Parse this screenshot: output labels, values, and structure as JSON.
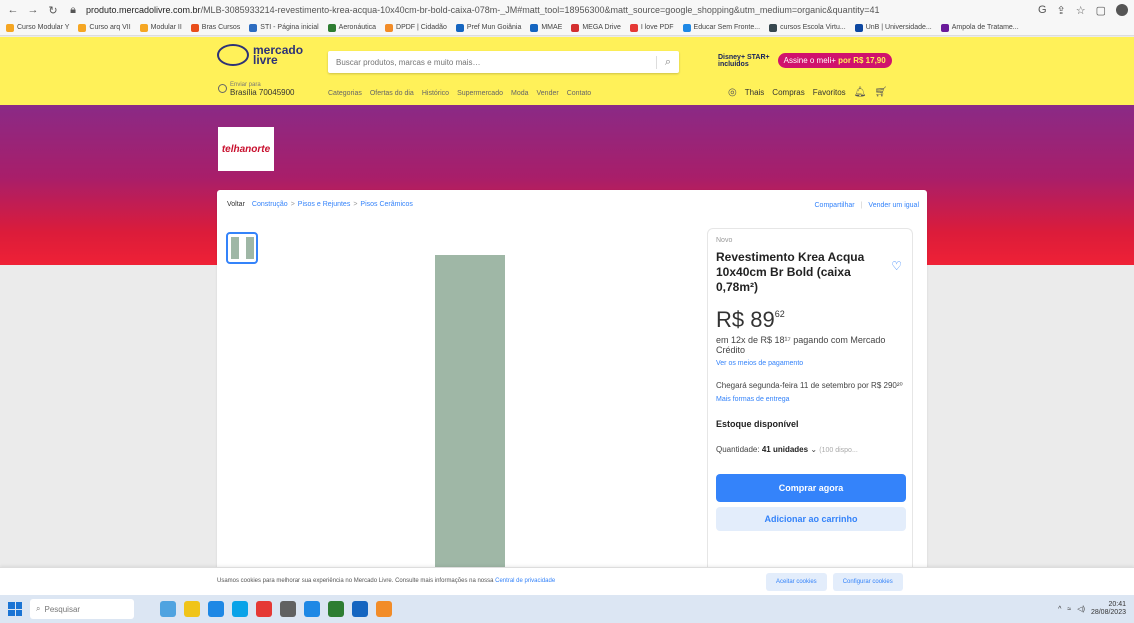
{
  "browser": {
    "url_host": "produto.mercadolivre.com.br",
    "url_rest": "/MLB-3085933214-revestimento-krea-acqua-10x40cm-br-bold-caixa-078m-_JM#matt_tool=18956300&matt_source=google_shopping&utm_medium=organic&quantity=41",
    "bookmarks": [
      {
        "label": "Curso Modular Y",
        "color": "#f5a623"
      },
      {
        "label": "Curso arq VII",
        "color": "#f5a623"
      },
      {
        "label": "Modular II",
        "color": "#f5a623"
      },
      {
        "label": "Bras Cursos",
        "color": "#e94e1b"
      },
      {
        "label": "STI - Página inicial",
        "color": "#2d6cc0"
      },
      {
        "label": "Aeronáutica",
        "color": "#2e7d32"
      },
      {
        "label": "DPDF | Cidadão",
        "color": "#f28c28"
      },
      {
        "label": "Pref Mun Goiânia",
        "color": "#1565c0"
      },
      {
        "label": "MMAE",
        "color": "#1565c0"
      },
      {
        "label": "MEGA Drive",
        "color": "#d32f2f"
      },
      {
        "label": "I love PDF",
        "color": "#e53935"
      },
      {
        "label": "Educar Sem Fronte...",
        "color": "#1e88e5"
      },
      {
        "label": "cursos Escola Virtu...",
        "color": "#37474f"
      },
      {
        "label": "UnB | Universidade...",
        "color": "#0d47a1"
      },
      {
        "label": "Ampola de Tratame...",
        "color": "#6a1b9a"
      }
    ]
  },
  "header": {
    "logo_line1": "mercado",
    "logo_line2": "livre",
    "search_placeholder": "Buscar produtos, marcas e muito mais…",
    "disney_line1": "Disney+ STAR+",
    "disney_line2": "incluídos",
    "assine_prefix": "Assine o",
    "assine_brand": "meli+",
    "assine_suffix": "por R$ 17,90",
    "addr_line1": "Enviar para",
    "addr_line2": "Brasília 70045900",
    "nav": [
      "Categorias",
      "Ofertas do dia",
      "Histórico",
      "Supermercado",
      "Moda",
      "Vender",
      "Contato"
    ],
    "user": "Thais",
    "compras": "Compras",
    "favoritos": "Favoritos"
  },
  "store": {
    "name": "telhanorte"
  },
  "breadcrumb": {
    "back": "Voltar",
    "items": [
      "Construção",
      "Pisos e Rejuntes",
      "Pisos Cerâmicos"
    ],
    "share": "Compartilhar",
    "sell": "Vender um igual"
  },
  "product": {
    "condition": "Novo",
    "title": "Revestimento Krea Acqua 10x40cm Br Bold (caixa 0,78m²)",
    "price_int": "R$ 89",
    "price_cents": "62",
    "installments": "em 12x de R$ 18¹⁷ pagando com Mercado Crédito",
    "payment_link": "Ver os meios de pagamento",
    "shipping": "Chegará segunda-feira 11 de setembro por R$ 290²⁰",
    "shipping_link": "Mais formas de entrega",
    "stock": "Estoque disponível",
    "qty_label": "Quantidade:",
    "qty_value": "41 unidades",
    "qty_avail": "(100 dispo...",
    "buy_label": "Comprar agora",
    "cart_label": "Adicionar ao carrinho",
    "tile_color": "#9fb7a6"
  },
  "cookie": {
    "message": "Usamos cookies para melhorar sua experiência no Mercado Livre. Consulte mais informações na nossa",
    "link": "Central de privacidade",
    "accept": "Aceitar cookies",
    "configure": "Configurar cookies"
  },
  "taskbar": {
    "search": "Pesquisar",
    "time": "20:41",
    "date": "28/08/2023",
    "apps": [
      "#4fa3e0",
      "#f0c419",
      "#1e88e5",
      "#0aa3e8",
      "#e53935",
      "#616161",
      "#1e88e5",
      "#2e7d32",
      "#1565c0",
      "#f28c28"
    ]
  }
}
